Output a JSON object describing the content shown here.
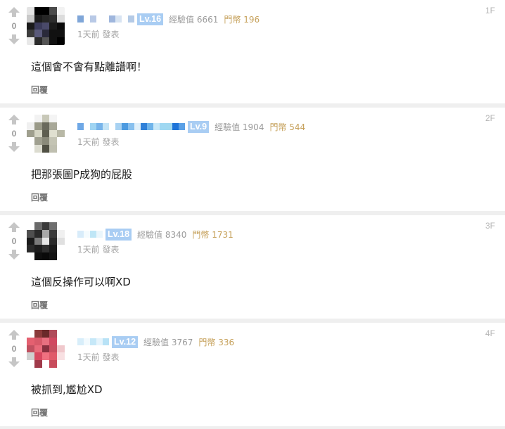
{
  "comments": [
    {
      "floor": "1F",
      "score": "0",
      "level": "Lv.16",
      "exp": "經驗值 6661",
      "gold": "門幣 196",
      "time": "1天前 發表",
      "content": "這個會不會有點離譜啊！",
      "reply": "回覆",
      "avatar_pixels": [
        "#e4e4e4",
        "#000000",
        "#000000",
        "#4a4a4a",
        "#f2f2f2",
        "#c9c9c9",
        "#1b1b1b",
        "#262626",
        "#2d2d2d",
        "#dcdcdc",
        "#1a1a1a",
        "#3b3b5a",
        "#4a4a6a",
        "#1a1a1a",
        "#0a0a0a",
        "#3c3c3c",
        "#5a5a7a",
        "#2a2a3a",
        "#111111",
        "#111111",
        "#e8e8e8",
        "#2b2b2b",
        "#555555",
        "#111111",
        "#000000"
      ],
      "username_pixels": [
        "#7fa6d8",
        "#ffffff",
        "#b8c9e6",
        "#ffffff",
        "#ffffff",
        "#9fb6dd",
        "#d8e4f2",
        "#ffffff",
        "#b4cae6"
      ]
    },
    {
      "floor": "2F",
      "score": "0",
      "level": "Lv.9",
      "exp": "經驗值 1904",
      "gold": "門幣 544",
      "time": "1天前 發表",
      "content": "把那張圖P成狗的屁股",
      "reply": "回覆",
      "avatar_pixels": [
        "#ffffff",
        "#f2f2f2",
        "#c8c8b8",
        "#f4f4f4",
        "#ffffff",
        "#f0f0f0",
        "#9a9a88",
        "#6a6a5c",
        "#a8a898",
        "#ffffff",
        "#9f9f8e",
        "#d5d5c4",
        "#5e5e50",
        "#e0e0d0",
        "#b8b8a6",
        "#ffffff",
        "#a0a090",
        "#8a8a7a",
        "#c4c4b4",
        "#ffffff",
        "#ffffff",
        "#dcdcd0",
        "#505044",
        "#bfbfb0",
        "#ffffff"
      ],
      "username_pixels": [
        "#6fa8e6",
        "#ffffff",
        "#9fd4f2",
        "#78b4ea",
        "#c4e4f6",
        "#ffffff",
        "#a8d2f2",
        "#4c9ae0",
        "#88c0ee",
        "#e0f0fa",
        "#2f80d8",
        "#6fb4ea",
        "#c8e8f8",
        "#9fd8f2",
        "#a0d8f0",
        "#1e74d8",
        "#5aa0e6"
      ]
    },
    {
      "floor": "3F",
      "score": "0",
      "level": "Lv.18",
      "exp": "經驗值 8340",
      "gold": "門幣 1731",
      "time": "1天前 發表",
      "content": "這個反操作可以啊XD",
      "reply": "回覆",
      "avatar_pixels": [
        "#ffffff",
        "#6a6a6a",
        "#3a3a3a",
        "#6f6f6f",
        "#ffffff",
        "#4f4f4f",
        "#2a2a2a",
        "#a8a8a8",
        "#3a3a3a",
        "#f0f0f0",
        "#1a1a1a",
        "#7a7a7a",
        "#e6e6e6",
        "#2a2a2a",
        "#e0e0e0",
        "#2a2a2a",
        "#1c1c1c",
        "#2f2f2f",
        "#1a1a1a",
        "#ffffff",
        "#ffffff",
        "#0f0f0f",
        "#0a0a0a",
        "#141414",
        "#ffffff"
      ],
      "username_pixels": [
        "#d8ecfa",
        "#f4fbfe",
        "#bfe6f6",
        "#eaf6fc"
      ]
    },
    {
      "floor": "4F",
      "score": "0",
      "level": "Lv.12",
      "exp": "經驗值 3767",
      "gold": "門幣 336",
      "time": "1天前 發表",
      "content": "被抓到,尷尬XD",
      "reply": "回覆",
      "avatar_pixels": [
        "#ffffff",
        "#8a3a3a",
        "#6a2a2a",
        "#b04b5a",
        "#ffffff",
        "#e46070",
        "#d85a6a",
        "#e87080",
        "#d04860",
        "#ffffff",
        "#c05060",
        "#e86a7a",
        "#8a3040",
        "#c84e60",
        "#f0c8cc",
        "#d0d0d0",
        "#d84860",
        "#f07080",
        "#e05a6a",
        "#f8e0e2",
        "#ffffff",
        "#a03a4a",
        "#ffffff",
        "#c84c5c",
        "#ffffff"
      ],
      "username_pixels": [
        "#d8eefa",
        "#f2fafe",
        "#c6e8f8",
        "#e6f4fc",
        "#b8e2f6"
      ]
    }
  ]
}
